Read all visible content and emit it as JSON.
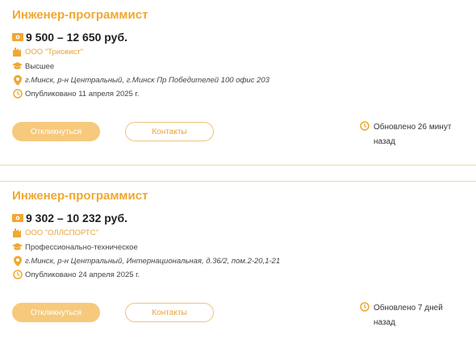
{
  "colors": {
    "accent": "#f0a830",
    "accent_light": "#f7c97c",
    "text_dark": "#1f1f1f",
    "text_muted": "#444444",
    "divider": "#f2d6a0"
  },
  "vacancies": [
    {
      "title": "Инженер-программист",
      "salary": "9 500 – 12 650 руб.",
      "company": "ООО \"Триовист\"",
      "education": "Высшее",
      "address": "г.Минск, р-н Центральный, г.Минск Пр Победителей 100 офис 203",
      "published": "Опубликовано 11 апреля 2025 г.",
      "apply_label": "Откликнуться",
      "contacts_label": "Контакты",
      "updated": "Обновлено 26 минут назад"
    },
    {
      "title": "Инженер-программист",
      "salary": "9 302 – 10 232 руб.",
      "company": "ООО \"ОЛЛСПОРТС\"",
      "education": "Профессионально-техническое",
      "address": "г.Минск, р-н Центральный, Интернациональная, д.36/2, пом.2-20,1-21",
      "published": "Опубликовано 24 апреля 2025 г.",
      "apply_label": "Откликнуться",
      "contacts_label": "Контакты",
      "updated": "Обновлено 7 дней назад"
    }
  ],
  "icons": {
    "salary": "money-icon",
    "company": "factory-icon",
    "education": "graduation-cap-icon",
    "address": "location-pin-icon",
    "published": "clock-icon",
    "updated": "clock-icon"
  }
}
